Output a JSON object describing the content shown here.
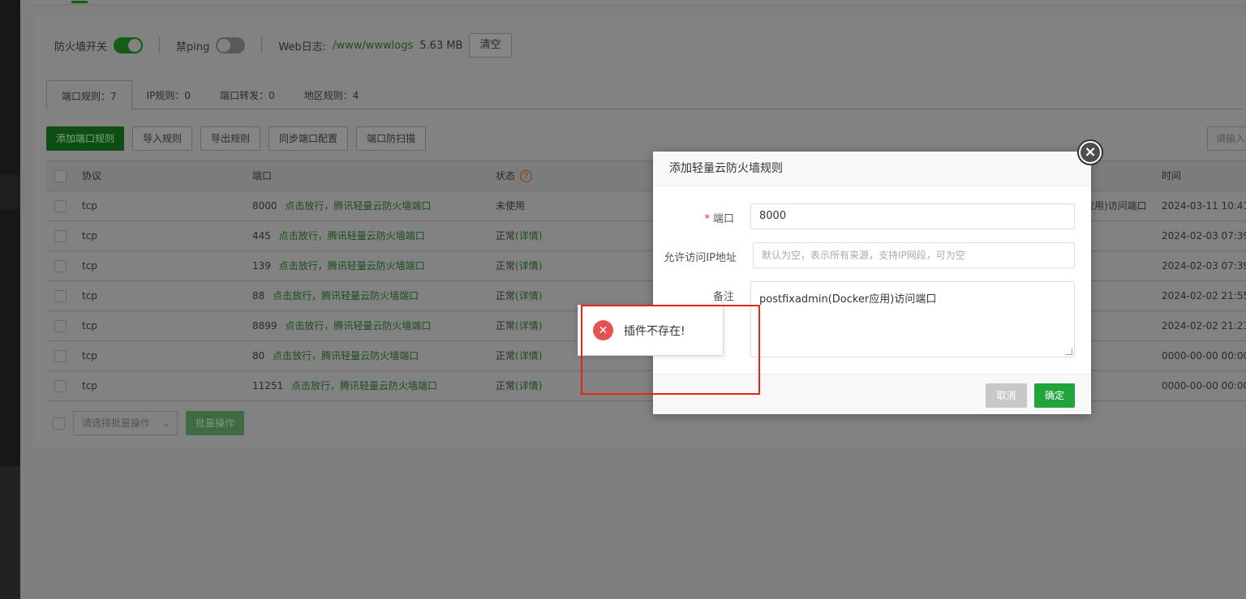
{
  "firewall": {
    "switch_label": "防火墙开关",
    "switch_on": true,
    "ping_label": "禁ping",
    "ping_on": false,
    "web_log_label": "Web日志:",
    "web_log_path": "/www/wwwlogs",
    "web_log_size": "5.63 MB",
    "clear_label": "清空"
  },
  "tabs": [
    {
      "label": "端口规则：7"
    },
    {
      "label": "IP规则：0"
    },
    {
      "label": "端口转发：0"
    },
    {
      "label": "地区规则：4"
    }
  ],
  "actions": {
    "add_port_rule": "添加端口规则",
    "import_rules": "导入规则",
    "export_rules": "导出规则",
    "sync_port_config": "同步端口配置",
    "port_scan_protect": "端口防扫描",
    "search_placeholder": "请输入"
  },
  "table": {
    "headers": {
      "protocol": "协议",
      "port": "端口",
      "status": "状态",
      "time": "时间"
    },
    "help_glyph": "?",
    "rows": [
      {
        "protocol": "tcp",
        "port": "8000",
        "link": "点击放行，腾讯轻量云防火墙端口",
        "status": "未使用",
        "detail": "",
        "remark": "应用)访问端口",
        "time": "2024-03-11 10:41:"
      },
      {
        "protocol": "tcp",
        "port": "445",
        "link": "点击放行，腾讯轻量云防火墙端口",
        "status": "正常",
        "detail": "(详情)",
        "remark": "",
        "time": "2024-02-03 07:39:"
      },
      {
        "protocol": "tcp",
        "port": "139",
        "link": "点击放行，腾讯轻量云防火墙端口",
        "status": "正常",
        "detail": "(详情)",
        "remark": "",
        "time": "2024-02-03 07:39:"
      },
      {
        "protocol": "tcp",
        "port": "88",
        "link": "点击放行，腾讯轻量云防火墙端口",
        "status": "正常",
        "detail": "(详情)",
        "remark": "",
        "time": "2024-02-02 21:55:"
      },
      {
        "protocol": "tcp",
        "port": "8899",
        "link": "点击放行，腾讯轻量云防火墙端口",
        "status": "正常",
        "detail": "(详情)",
        "remark": "",
        "time": "2024-02-02 21:23:"
      },
      {
        "protocol": "tcp",
        "port": "80",
        "link": "点击放行，腾讯轻量云防火墙端口",
        "status": "正常",
        "detail": "(详情)",
        "remark": "",
        "time": "0000-00-00 00:00:"
      },
      {
        "protocol": "tcp",
        "port": "11251",
        "link": "点击放行，腾讯轻量云防火墙端口",
        "status": "正常",
        "detail": "(详情)",
        "remark": "",
        "time": "0000-00-00 00:00:"
      }
    ]
  },
  "batch": {
    "select_placeholder": "请选择批量操作",
    "button": "批量操作"
  },
  "modal": {
    "title": "添加轻量云防火墙规则",
    "close_glyph": "×",
    "port_label": "端口",
    "required_mark": "*",
    "port_value": "8000",
    "ip_label": "允许访问IP地址",
    "ip_placeholder": "默认为空，表示所有来源，支持IP网段，可为空",
    "remark_label": "备注",
    "remark_value": "postfixadmin(Docker应用)访问端口",
    "cancel": "取消",
    "confirm": "确定"
  },
  "toast": {
    "icon_glyph": "✕",
    "message": "插件不存在!"
  },
  "colors": {
    "accent_green": "#20a53a",
    "error_red": "#e65252",
    "highlight_red": "#e3251b"
  }
}
